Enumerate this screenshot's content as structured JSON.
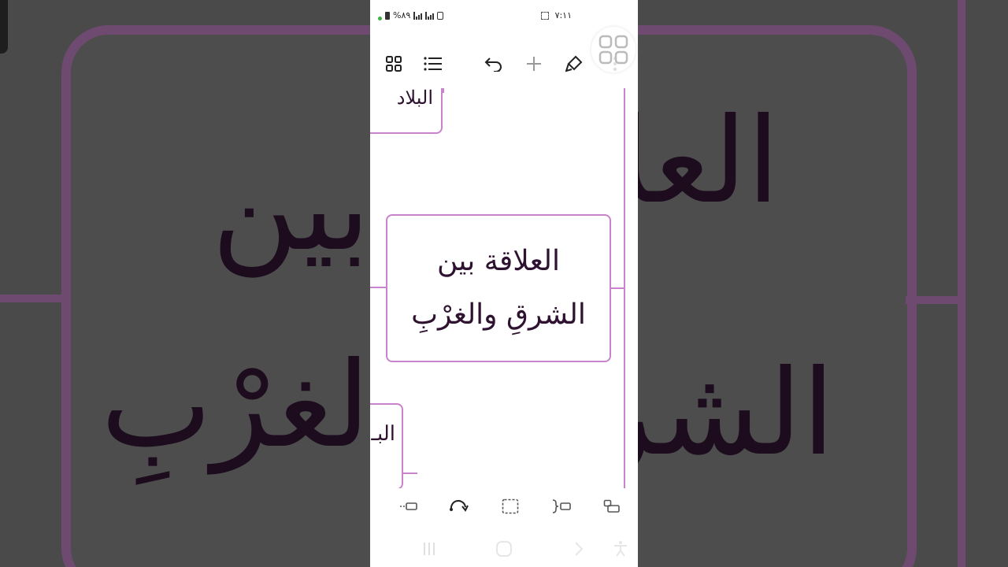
{
  "status_bar": {
    "battery_percent": "%٨٩",
    "time": "٧:١١"
  },
  "toolbar": {
    "icons": [
      "grid-icon",
      "list-icon",
      "undo-icon",
      "add-icon",
      "style-brush-icon",
      "more-vertical-icon"
    ]
  },
  "mindmap": {
    "main_topic_line1": "العلاقة بين",
    "main_topic_line2": "الشرقِ والغرْبِ",
    "top_node_text": "البلاد",
    "bottom_node_text": "البـ"
  },
  "background": {
    "line1_right": "العلا",
    "line1_left": "بين",
    "line2_right": "الشر",
    "line2_left": "لغرْبِ"
  },
  "edit_bar": {
    "icons": [
      "add-sibling-icon",
      "redo-icon",
      "select-frame-icon",
      "add-bracket-icon",
      "add-child-icon"
    ]
  },
  "nav_bar": {
    "icons": [
      "recent-apps-icon",
      "home-icon",
      "back-icon",
      "accessibility-icon"
    ]
  },
  "colors": {
    "accent": "#c983cc",
    "text": "#2e1230",
    "background_dim": "#4a4a4a"
  }
}
